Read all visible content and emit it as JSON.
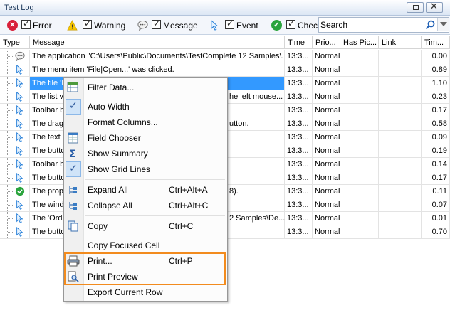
{
  "window": {
    "title": "Test Log"
  },
  "toolbar": {
    "filters": [
      {
        "label": "Error",
        "checked": true,
        "icon": "error-icon"
      },
      {
        "label": "Warning",
        "checked": true,
        "icon": "warning-icon"
      },
      {
        "label": "Message",
        "checked": true,
        "icon": "message-icon"
      },
      {
        "label": "Event",
        "checked": true,
        "icon": "event-icon"
      },
      {
        "label": "Check",
        "checked": true,
        "icon": "checkpoint-icon"
      }
    ],
    "search_value": "Search"
  },
  "columns": [
    "Type",
    "Message",
    "Time",
    "Prio...",
    "Has Pic...",
    "Link",
    "Tim..."
  ],
  "rows": [
    {
      "type": "message",
      "message": "The application \"C:\\Users\\Public\\Documents\\TestComplete 12 Samples\\...",
      "time": "13:3...",
      "priority": "Normal",
      "duration": "0.00"
    },
    {
      "type": "event",
      "message": "The menu item 'File|Open...' was clicked.",
      "time": "13:3...",
      "priority": "Normal",
      "duration": "0.89"
    },
    {
      "type": "event",
      "message": "The file 'N",
      "time": "13:3...",
      "priority": "Normal",
      "duration": "1.10",
      "selected": true
    },
    {
      "type": "event",
      "message": "The list vi",
      "message_tail": "he left mouse...",
      "time": "13:3...",
      "priority": "Normal",
      "duration": "0.23"
    },
    {
      "type": "event",
      "message": "Toolbar b",
      "time": "13:3...",
      "priority": "Normal",
      "duration": "0.17"
    },
    {
      "type": "event",
      "message": "The drag",
      "message_tail": "utton.",
      "time": "13:3...",
      "priority": "Normal",
      "duration": "0.58"
    },
    {
      "type": "event",
      "message": "The text",
      "time": "13:3...",
      "priority": "Normal",
      "duration": "0.09"
    },
    {
      "type": "event",
      "message": "The butto",
      "time": "13:3...",
      "priority": "Normal",
      "duration": "0.19"
    },
    {
      "type": "event",
      "message": "Toolbar b",
      "time": "13:3...",
      "priority": "Normal",
      "duration": "0.14"
    },
    {
      "type": "event",
      "message": "The butto",
      "time": "13:3...",
      "priority": "Normal",
      "duration": "0.17"
    },
    {
      "type": "check",
      "message": "The prope",
      "message_tail": "8).",
      "time": "13:3...",
      "priority": "Normal",
      "duration": "0.11"
    },
    {
      "type": "event",
      "message": "The windo",
      "time": "13:3...",
      "priority": "Normal",
      "duration": "0.07"
    },
    {
      "type": "event",
      "message": "The 'Orde",
      "message_tail": "2 Samples\\De...",
      "time": "13:3...",
      "priority": "Normal",
      "duration": "0.01"
    },
    {
      "type": "event",
      "message": "The butto",
      "time": "13:3...",
      "priority": "Normal",
      "duration": "0.70"
    }
  ],
  "context_menu": {
    "items": [
      {
        "label": "Filter Data...",
        "icon": "filter-icon"
      },
      {
        "label": "Auto Width",
        "checked": true
      },
      {
        "label": "Format Columns..."
      },
      {
        "label": "Field Chooser",
        "icon": "field-chooser-icon"
      },
      {
        "label": "Show Summary",
        "icon": "sigma-icon"
      },
      {
        "label": "Show Grid Lines",
        "checked": true
      },
      {
        "label": "Expand All",
        "shortcut": "Ctrl+Alt+A",
        "icon": "expand-all-icon"
      },
      {
        "label": "Collapse All",
        "shortcut": "Ctrl+Alt+C",
        "icon": "collapse-all-icon"
      },
      {
        "label": "Copy",
        "shortcut": "Ctrl+C",
        "icon": "copy-icon"
      },
      {
        "label": "Copy Focused Cell"
      },
      {
        "label": "Print...",
        "shortcut": "Ctrl+P",
        "icon": "print-icon"
      },
      {
        "label": "Print Preview",
        "icon": "print-preview-icon"
      },
      {
        "label": "Export Current Row"
      }
    ]
  },
  "colors": {
    "selection": "#3399ff",
    "highlight_box": "#f28b1e",
    "check_bg": "#d0e4f8"
  }
}
